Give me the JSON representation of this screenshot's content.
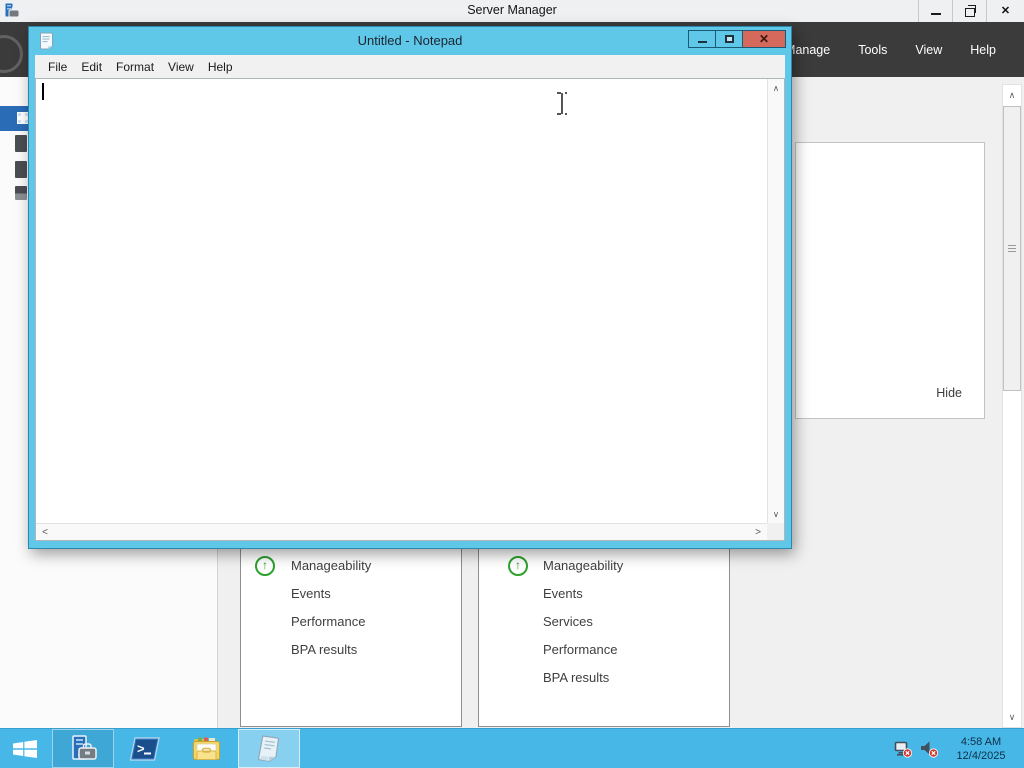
{
  "server_manager": {
    "window_title": "Server Manager",
    "menubar": {
      "manage": "Manage",
      "tools": "Tools",
      "view": "View",
      "help": "Help"
    },
    "dashboard": {
      "hide_label": "Hide",
      "tiles": [
        {
          "rows": [
            {
              "icon": "up-arrow-circle",
              "label": "Manageability"
            },
            {
              "label": "Events"
            },
            {
              "label": "Performance"
            },
            {
              "label": "BPA results"
            }
          ]
        },
        {
          "rows": [
            {
              "icon": "up-arrow-circle",
              "label": "Manageability"
            },
            {
              "label": "Events"
            },
            {
              "label": "Services"
            },
            {
              "label": "Performance"
            },
            {
              "label": "BPA results"
            }
          ]
        }
      ]
    }
  },
  "notepad": {
    "window_title": "Untitled - Notepad",
    "menubar": {
      "file": "File",
      "edit": "Edit",
      "format": "Format",
      "view": "View",
      "help": "Help"
    },
    "text_content": ""
  },
  "taskbar": {
    "clock": {
      "time": "4:58 AM",
      "date": "12/4/2025"
    },
    "buttons": [
      "start",
      "server-manager",
      "powershell",
      "file-explorer",
      "notepad"
    ],
    "tray_icons": [
      "network-disconnected-icon",
      "volume-muted-icon"
    ]
  },
  "glyphs": {
    "close": "✕",
    "scroll_up": "∧",
    "scroll_down": "∨",
    "scroll_left": "<",
    "scroll_right": ">",
    "up_arrow": "↑"
  },
  "colors": {
    "taskbar": "#47b7e7",
    "notepad_chrome": "#5fc8e8",
    "close_button": "#d4695c",
    "dark_menubar": "#3b3b3b",
    "selected_nav": "#2a6cb5",
    "manageability_green": "#2ca22c"
  }
}
